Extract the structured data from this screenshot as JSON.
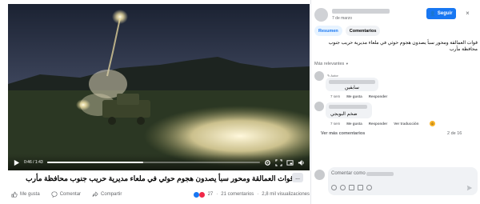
{
  "video": {
    "time_current": "0:46",
    "time_total": "1:43",
    "progress_fraction": 0.45
  },
  "post": {
    "caption": "قوات العمالقة ومحور سبأ يصدون هجوم حوثي في ملعاء مديرية حريب جنوب محافظة مأرب",
    "more_label": "...",
    "actions": {
      "like": "Me gusta",
      "comment": "Comentar",
      "share": "Compartir"
    },
    "stats": {
      "reactions": "27",
      "comments": "21 comentarios",
      "views": "2,8 mil visualizaciones"
    }
  },
  "side": {
    "date": "7 de marzo",
    "follow_label": "Seguir",
    "close_glyph": "×",
    "tabs": [
      "Resumen",
      "Comentarios"
    ],
    "post_text": "قوات العمالقة ومحور سبأ يصدون هجوم حوثي في ملعاء مديرية حريب جنوب محافظة مأرب",
    "relevance_label": "Más relevantes",
    "comments": [
      {
        "author_tag": "Autor",
        "text": "سابقين",
        "time": "7 sem",
        "like": "Me gusta",
        "reply": "Responder"
      },
      {
        "text": "ضخم البوبجي",
        "time": "7 sem",
        "like": "Me gusta",
        "reply": "Responder",
        "translate": "Ver traducción"
      }
    ],
    "more_comments": "Ver más comentarios",
    "pager": "2 de 16",
    "composer_placeholder": "Comentar como"
  },
  "colors": {
    "accent": "#1877f2",
    "sky_top": "#20283a",
    "ground": "#2a3a22",
    "flash": "#fff3c4"
  }
}
